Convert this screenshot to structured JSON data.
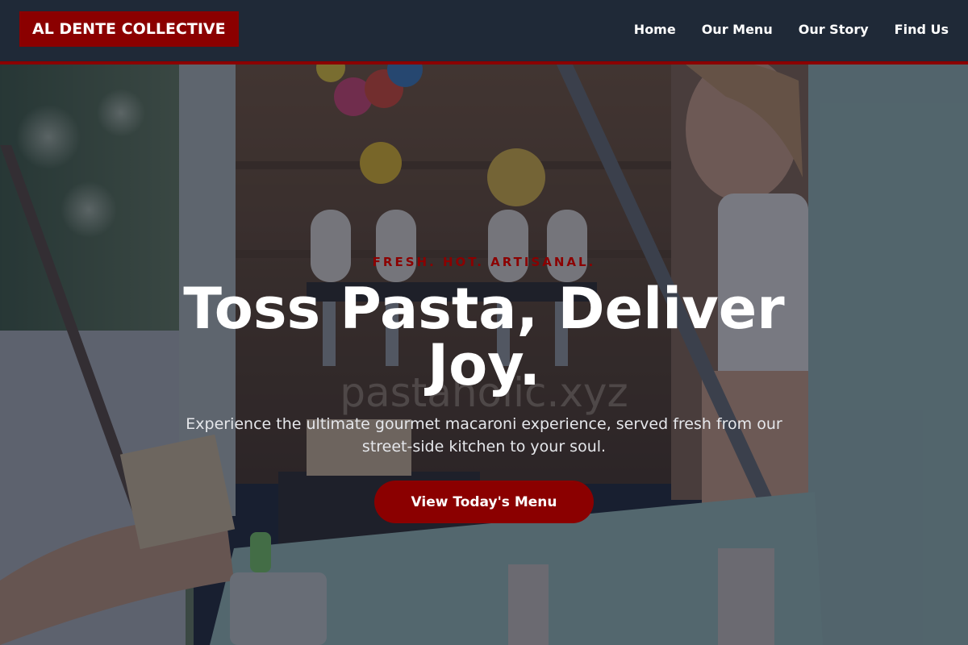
{
  "brand": {
    "logo_text": "AL DENTE COLLECTIVE"
  },
  "nav": {
    "items": [
      {
        "label": "Home"
      },
      {
        "label": "Our Menu"
      },
      {
        "label": "Our Story"
      },
      {
        "label": "Find Us"
      }
    ]
  },
  "hero": {
    "eyebrow": "FRESH. HOT. ARTISANAL.",
    "headline": "Toss Pasta, Deliver Joy.",
    "watermark": "pastaholic.xyz",
    "subtitle": "Experience the ultimate gourmet macaroni experience, served fresh from our street-side kitchen to your soul.",
    "cta_label": "View Today's Menu",
    "background": "food-truck-photo"
  },
  "colors": {
    "accent": "#8b0000",
    "nav_bg": "#1f2937",
    "text": "#ffffff"
  }
}
